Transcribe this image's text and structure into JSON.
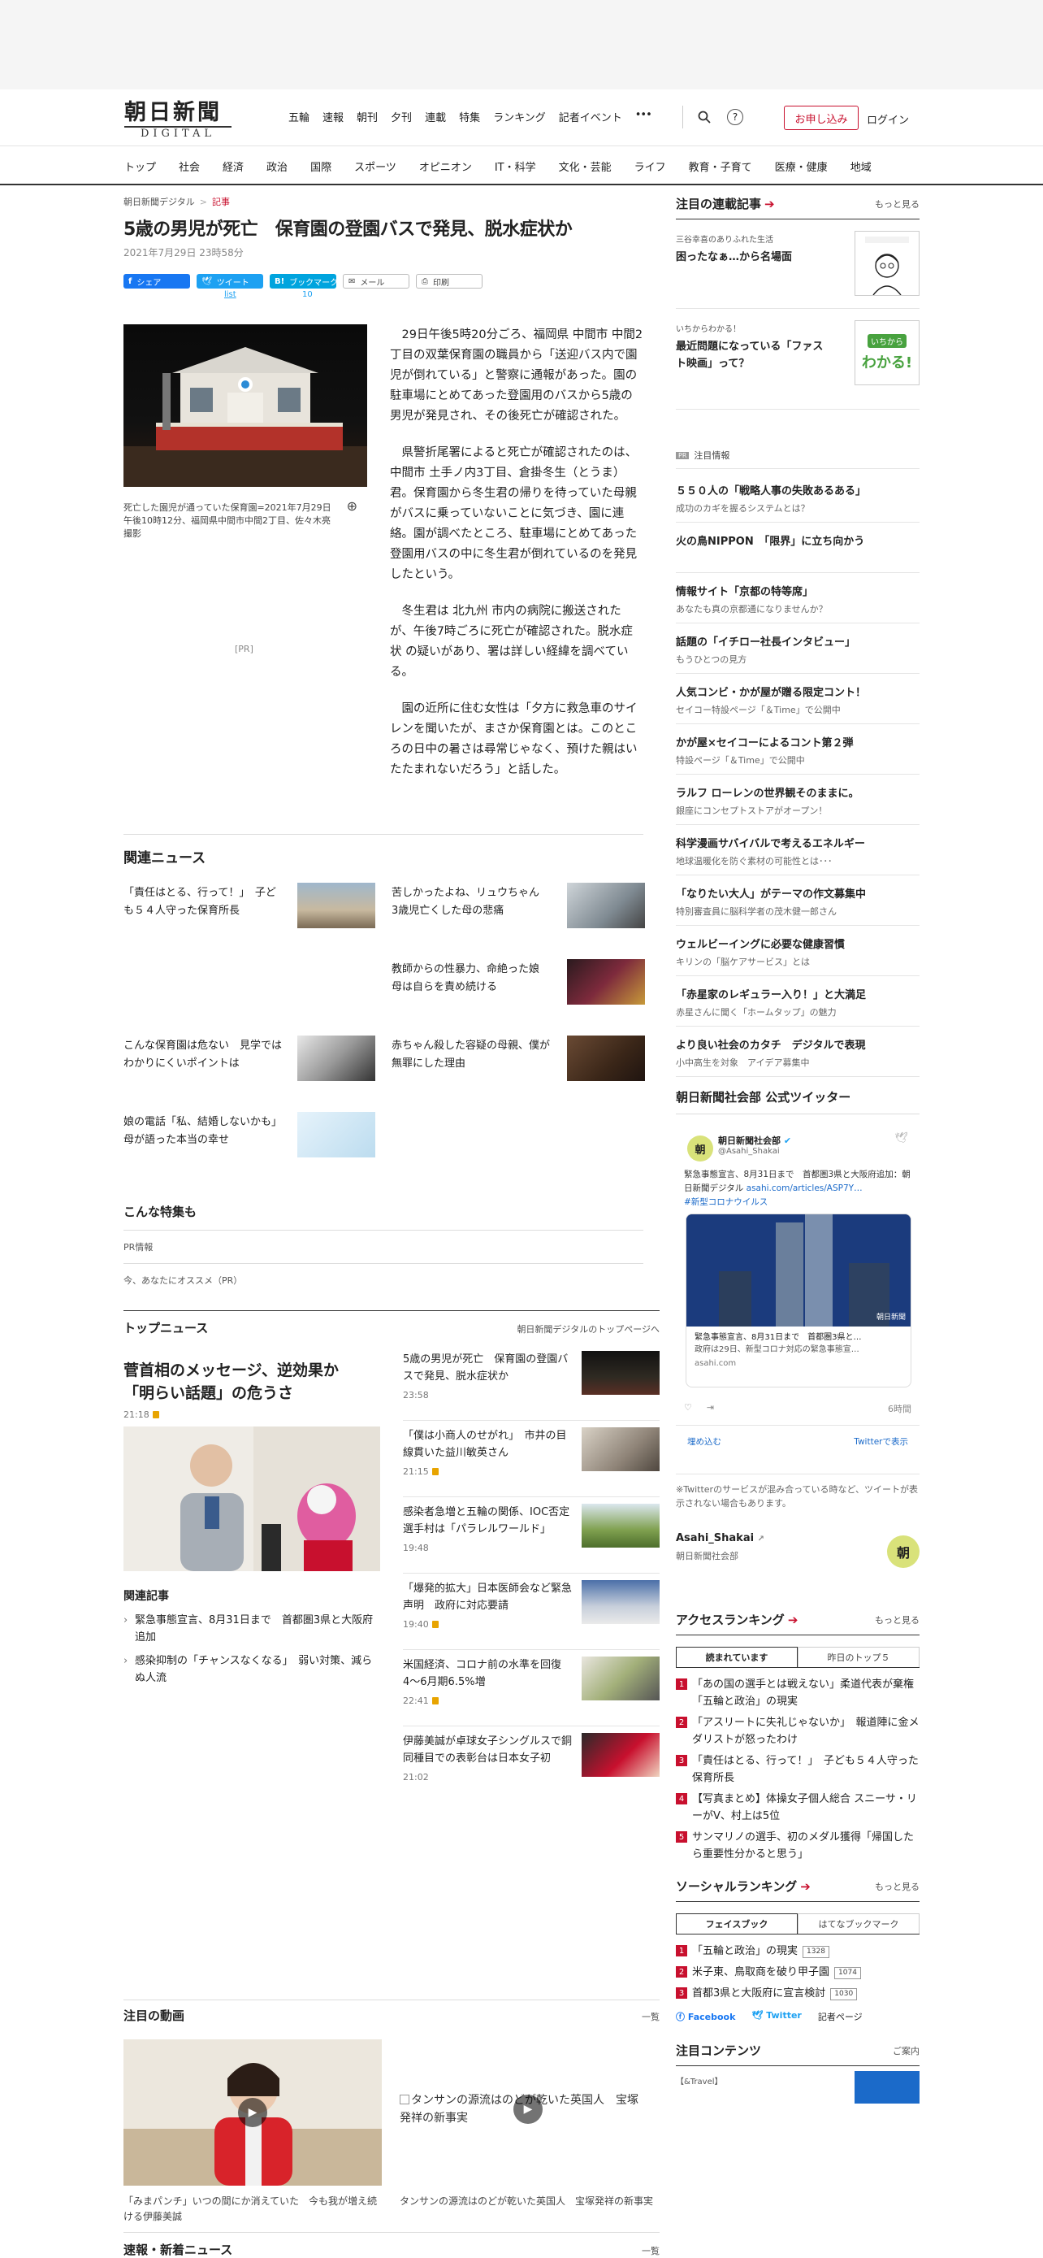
{
  "header": {
    "logo_main": "朝日新聞",
    "logo_sub": "DIGITAL",
    "links": [
      "五輪",
      "速報",
      "朝刊",
      "夕刊",
      "連載",
      "特集",
      "ランキング",
      "記者イベント"
    ],
    "more": "•••",
    "subscribe": "お申し込み",
    "login": "ログイン"
  },
  "categories": [
    "トップ",
    "社会",
    "経済",
    "政治",
    "国際",
    "スポーツ",
    "オピニオン",
    "IT・科学",
    "文化・芸能",
    "ライフ",
    "教育・子育て",
    "医療・健康",
    "地域"
  ],
  "breadcrumb": {
    "home": "朝日新聞デジタル",
    "sep": ">",
    "current": "記事"
  },
  "article": {
    "title": "5歳の男児が死亡　保育園の登園バスで発見、脱水症状か",
    "date": "2021年7月29日 23時58分",
    "share": {
      "facebook": "シェア",
      "tweet": "ツイート",
      "tweet_count": "list",
      "hatena": "ブックマーク",
      "hatena_count": "10",
      "mail": "メール",
      "print": "印刷"
    },
    "photo_caption": "死亡した園児が通っていた保育園=2021年7月29日午後10時12分、福岡県中間市中間2丁目、佐々木亮撮影",
    "pr": "[PR]",
    "paragraphs": [
      "29日午後5時20分ごろ、福岡県 中間市 中間2丁目の双葉保育園の職員から「送迎バス内で園児が倒れている」と警察に通報があった。園の駐車場にとめてあった登園用のバスから5歳の男児が発見され、その後死亡が確認された。",
      "県警折尾署によると死亡が確認されたのは、中間市 土手ノ内3丁目、倉掛冬生（とうま）君。保育園から冬生君の帰りを待っていた母親がバスに乗っていないことに気づき、園に連絡。園が調べたところ、駐車場にとめてあった登園用バスの中に冬生君が倒れているのを発見したという。",
      "冬生君は 北九州 市内の病院に搬送されたが、午後7時ごろに死亡が確認された。脱水症状 の疑いがあり、署は詳しい経緯を調べている。",
      "園の近所に住む女性は「夕方に救急車のサイレンを聞いたが、まさか保育園とは。このところの日中の暑さは尋常じゃなく、預けた親はいたたまれないだろう」と話した。"
    ]
  },
  "related_news": {
    "title": "関連ニュース",
    "items": [
      "「責任はとる、行って！」　子ども５４人守った保育所長",
      "苦しかったよね、リュウちゃん　3歳児亡くした母の悲痛",
      "教師からの性暴力、命絶った娘　母は自らを責め続ける",
      "こんな保育園は危ない　見学ではわかりにくいポイントは",
      "赤ちゃん殺した容疑の母親、僕が無罪にした理由",
      "娘の電話「私、結婚しないかも」　母が語った本当の幸せ"
    ]
  },
  "special": {
    "title": "こんな特集も",
    "pr_info": "PR情報",
    "recommend": "今、あなたにオススメ（PR）"
  },
  "top_news": {
    "title": "トップニュース",
    "more": "朝日新聞デジタルのトップページへ",
    "lead": {
      "title": "菅首相のメッセージ、逆効果か　「明らい話題」の危うさ",
      "time": "21:18"
    },
    "related_title": "関連記事",
    "related": [
      "緊急事態宣言、8月31日まで　首都圏3県と大阪府追加",
      "感染抑制の「チャンスなくなる」　弱い対策、減らぬ人流"
    ],
    "items": [
      {
        "title": "5歳の男児が死亡　保育園の登園バスで発見、脱水症状か",
        "time": "23:58",
        "lock": false
      },
      {
        "title": "「僕は小商人のせがれ」　市井の目線貫いた益川敏英さん",
        "time": "21:15",
        "lock": true
      },
      {
        "title": "感染者急増と五輪の関係、IOC否定　選手村は「パラレルワールド」",
        "time": "19:48",
        "lock": false
      },
      {
        "title": "「爆発的拡大」日本医師会など緊急声明　政府に対応要請",
        "time": "19:40",
        "lock": true
      },
      {
        "title": "米国経済、コロナ前の水準を回復　4～6月期6.5%増",
        "time": "22:41",
        "lock": true
      },
      {
        "title": "伊藤美誠が卓球女子シングルスで銅　同種目での表彰台は日本女子初",
        "time": "21:02",
        "lock": false
      }
    ]
  },
  "videos": {
    "title": "注目の動画",
    "more": "一覧",
    "items": [
      "「みまパンチ」いつの間にか消えていた　今も我が増え続ける伊藤美誠",
      "タンサンの源流はのどが乾いた英国人　宝塚発祥の新事実"
    ],
    "broken_alt": "タンサンの源流はのどが乾いた英国人　宝塚発祥の新事実"
  },
  "breaking": {
    "title": "速報・新着ニュース",
    "more": "一覧"
  },
  "sidebar": {
    "serial": {
      "title": "注目の連載記事",
      "more": "もっと見る",
      "items": [
        {
          "kicker": "三谷幸喜のありふれた生活",
          "title": "困ったなぁ…から名場面"
        },
        {
          "kicker": "いちからわかる！",
          "title": "最近問題になっている「ファスト映画」って？"
        }
      ],
      "wakaru_top": "いちから",
      "wakaru_big": "わかる!"
    },
    "pr": {
      "tag": "PR",
      "title": "注目情報",
      "items": [
        {
          "t": "５５０人の「戦略人事の失敗あるある」",
          "s": "成功のカギを握るシステムとは？"
        },
        {
          "t": "火の鳥NIPPON　「限界」に立ち向かう",
          "s": ""
        },
        {
          "t": "情報サイト「京都の特等席」",
          "s": "あなたも真の京都通になりませんか？"
        },
        {
          "t": "話題の「イチロー社長インタビュー」",
          "s": "もうひとつの見方"
        },
        {
          "t": "人気コンビ・かが屋が贈る限定コント！",
          "s": "セイコー特設ページ「＆Time」で公開中"
        },
        {
          "t": "かが屋×セイコーによるコント第２弾",
          "s": "特設ページ「＆Time」で公開中"
        },
        {
          "t": "ラルフ ローレンの世界観そのままに。",
          "s": "銀座にコンセプトストアがオープン！"
        },
        {
          "t": "科学漫画サバイバルで考えるエネルギー",
          "s": "地球温暖化を防ぐ素材の可能性とは･･･"
        },
        {
          "t": "「なりたい大人」がテーマの作文募集中",
          "s": "特別審査員に脳科学者の茂木健一郎さん"
        },
        {
          "t": "ウェルビーイングに必要な健康習慣",
          "s": "キリンの「脳ケアサービス」とは"
        },
        {
          "t": "「赤星家のレギュラー入り！」と大満足",
          "s": "赤星さんに聞く「ホームタップ」の魅力"
        },
        {
          "t": "より良い社会のカタチ　デジタルで表現",
          "s": "小中高生を対象　アイデア募集中"
        }
      ]
    },
    "twitter": {
      "title": "朝日新聞社会部 公式ツイッター",
      "name": "朝日新聞社会部",
      "handle": "@Asahi_Shakai",
      "avatar": "朝",
      "text": "緊急事態宣言、8月31日まで　首都圏3県と大阪府追加：朝日新聞デジタル",
      "link": "asahi.com/articles/ASP7Y…",
      "tag": "#新型コロナウイルス",
      "card_title": "緊急事態宣言、8月31日まで　首都圏3県と…",
      "card_desc": "政府は29日、新型コロナ対応の緊急事態宣…",
      "card_domain": "asahi.com",
      "card_logo": "朝日新聞",
      "ago": "6時間",
      "embed": "埋め込む",
      "view": "Twitterで表示",
      "note": "※Twitterのサービスが混み合っている時など、ツイートが表示されない場合もあります。",
      "acct_name": "Asahi_Shakai",
      "acct_desc": "朝日新聞社会部"
    },
    "ranking": {
      "title": "アクセスランキング",
      "more": "もっと見る",
      "tabs": [
        "読まれています",
        "昨日のトップ５"
      ],
      "items": [
        "「あの国の選手とは戦えない」柔道代表が棄権　「五輪と政治」の現実",
        "「アスリートに失礼じゃないか」　報道陣に金メダリストが怒ったわけ",
        "「責任はとる、行って！」　子ども５４人守った保育所長",
        "【写真まとめ】体操女子個人総合 スニーサ・リーがV、村上は5位",
        "サンマリノの選手、初のメダル獲得「帰国したら重要性分かると思う」"
      ]
    },
    "social": {
      "title": "ソーシャルランキング",
      "more": "もっと見る",
      "tabs": [
        "フェイスブック",
        "はてなブックマーク"
      ],
      "items": [
        {
          "t": "「五輪と政治」の現実",
          "c": "1328"
        },
        {
          "t": "米子東、鳥取商を破り甲子園",
          "c": "1074"
        },
        {
          "t": "首都3県と大阪府に宣言検討",
          "c": "1030"
        }
      ],
      "links": [
        "Facebook",
        "Twitter",
        "記者ページ"
      ]
    },
    "featured": {
      "title": "注目コンテンツ",
      "more": "ご案内",
      "sub": "【&Travel】"
    }
  }
}
